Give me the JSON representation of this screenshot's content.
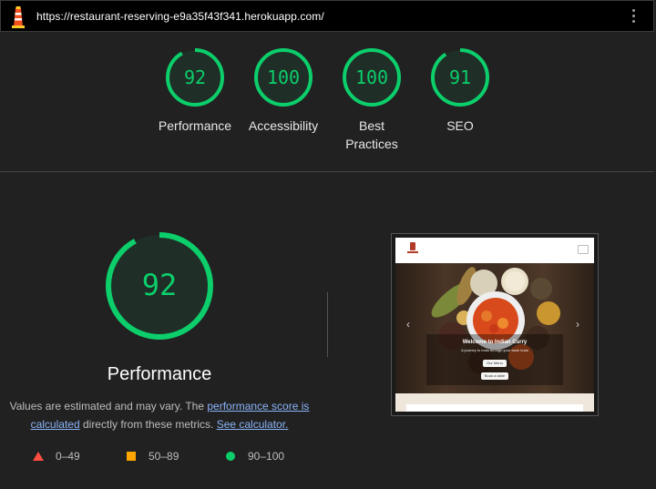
{
  "header": {
    "url": "https://restaurant-reserving-e9a35f43f341.herokuapp.com/"
  },
  "summary_scores": [
    {
      "label": "Performance",
      "score": "92"
    },
    {
      "label": "Accessibility",
      "score": "100"
    },
    {
      "label": "Best Practices",
      "score": "100"
    },
    {
      "label": "SEO",
      "score": "91"
    }
  ],
  "colors": {
    "pass": "#0cce6b",
    "average": "#ffa400",
    "fail": "#ff4e42"
  },
  "main": {
    "score": "92",
    "title": "Performance",
    "desc_prefix": "Values are estimated and may vary. The ",
    "desc_link1": "performance score is calculated",
    "desc_middle": " directly from these metrics. ",
    "desc_link2": "See calculator."
  },
  "legend": [
    {
      "range": "0–49",
      "icon": "triangle-icon"
    },
    {
      "range": "50–89",
      "icon": "square-icon"
    },
    {
      "range": "90–100",
      "icon": "circle-icon"
    }
  ],
  "screenshot": {
    "hero_title": "Welcome to Indian Curry",
    "hero_subtitle": "A journey to india through your taste buds",
    "menu_button": "Our Menu",
    "book_button": "Book a table"
  }
}
